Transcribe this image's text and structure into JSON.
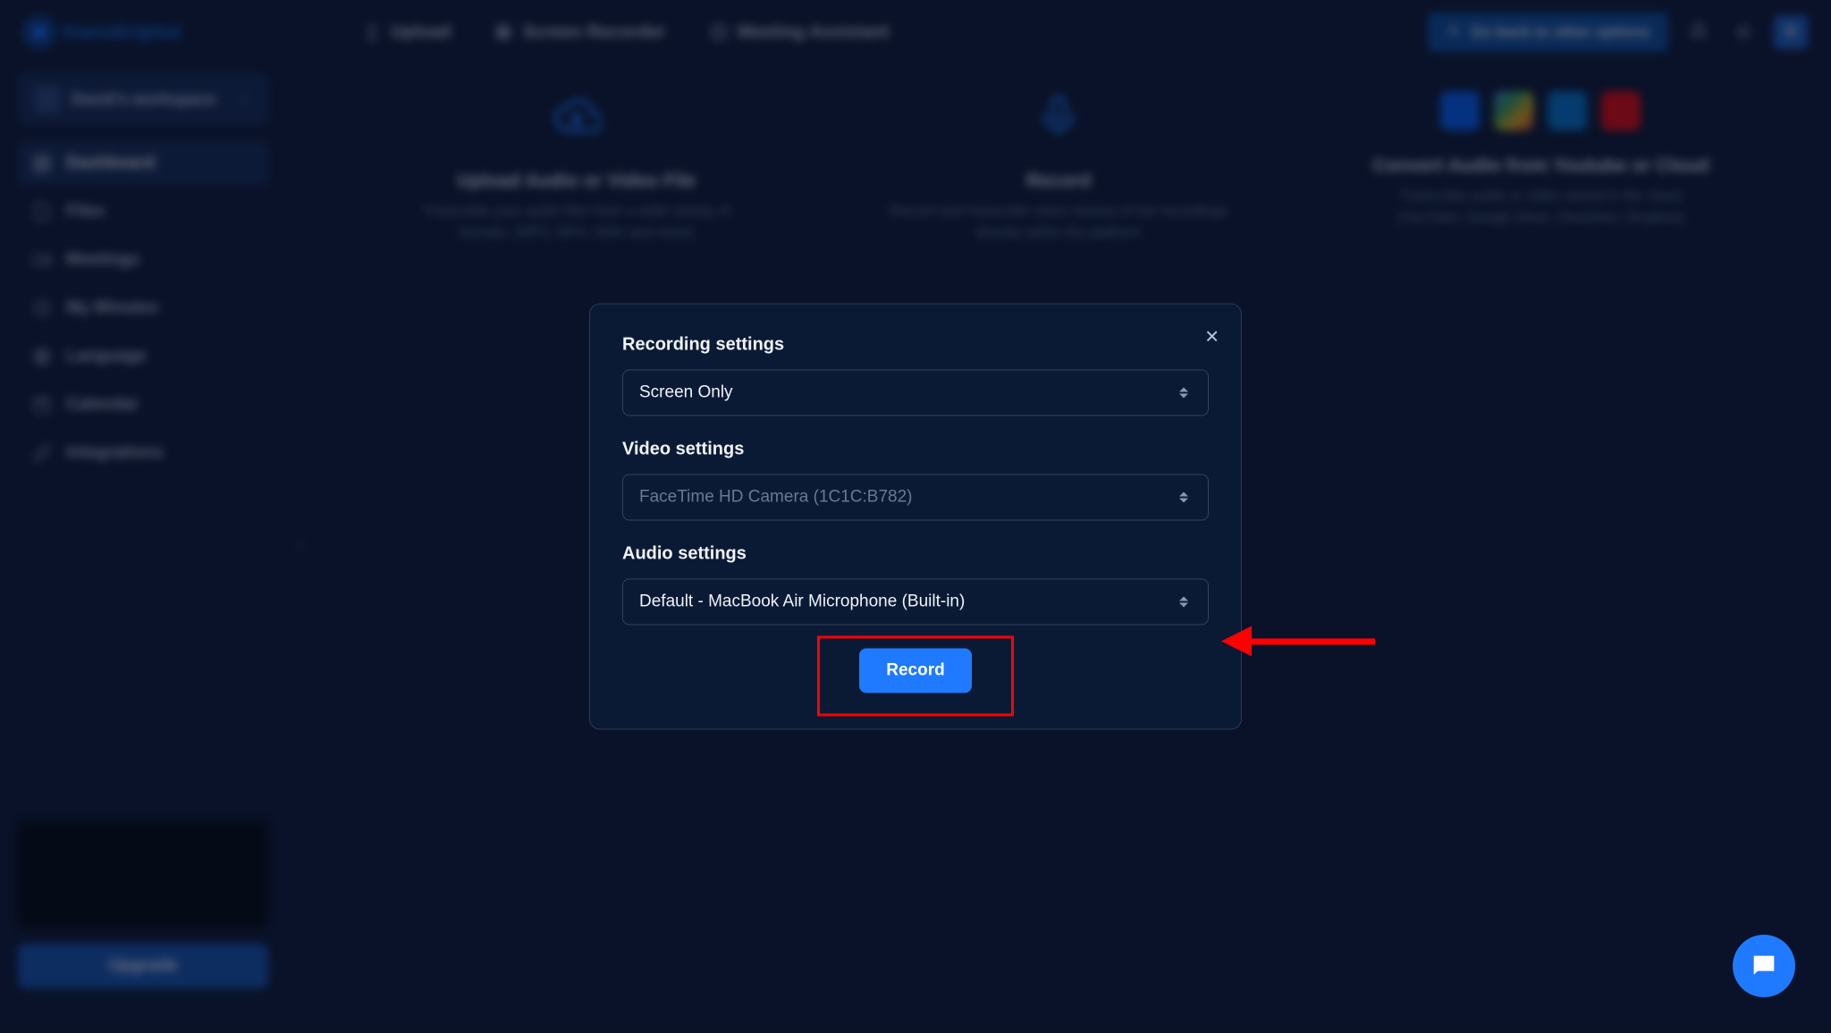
{
  "brand": "transkriptor",
  "topbar": {
    "tabs": [
      {
        "label": "Upload",
        "icon": "upload-icon"
      },
      {
        "label": "Screen Recorder",
        "icon": "record-icon"
      },
      {
        "label": "Meeting Assistant",
        "icon": "meeting-icon"
      }
    ],
    "upgrade_label": "Go back to other options",
    "avatar_initial": "D"
  },
  "workspace": {
    "name": "David's workspace"
  },
  "sidebar": {
    "items": [
      {
        "label": "Dashboard",
        "active": true
      },
      {
        "label": "Files",
        "active": false
      },
      {
        "label": "Meetings",
        "active": false
      },
      {
        "label": "My Minutes",
        "active": false
      },
      {
        "label": "Language",
        "active": false
      },
      {
        "label": "Calendar",
        "active": false
      },
      {
        "label": "Integrations",
        "active": false
      }
    ],
    "upgrade_label": "Upgrade"
  },
  "cards": {
    "upload": {
      "title": "Upload Audio or Video File",
      "desc": "Transcribe your audio files from a wide variety of formats. (MP3, MP4, WAV and more)"
    },
    "record": {
      "title": "Record",
      "desc": "Record and transcribe voice memos & live recordings directly within the platform"
    },
    "cloud": {
      "title": "Convert Audio from Youtube or Cloud",
      "desc": "Transcribe audio or video stored in the cloud (YouTube, Google Drive, OneDrive, Dropbox)"
    }
  },
  "modal": {
    "sections": {
      "recording": {
        "label": "Recording settings",
        "value": "Screen Only"
      },
      "video": {
        "label": "Video settings",
        "value": "FaceTime HD Camera (1C1C:B782)"
      },
      "audio": {
        "label": "Audio settings",
        "value": "Default - MacBook Air Microphone (Built-in)"
      }
    },
    "record_button": "Record"
  }
}
